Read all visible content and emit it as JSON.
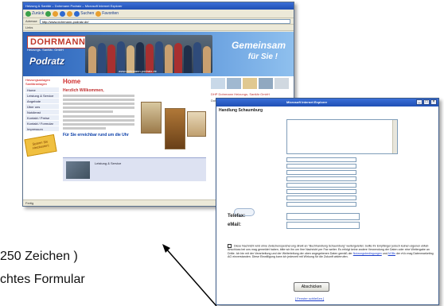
{
  "browser": {
    "title": "Heizung & Sanitär – Dohrmann Podratz – Microsoft Internet Explorer",
    "toolbar": [
      "Zurück",
      "",
      "",
      "",
      "",
      "Suchen",
      "Favoriten"
    ],
    "address_label": "Adresse",
    "address_value": "http://www.dohrmann-podratz.de/",
    "links_label": "Links",
    "status_text": "Fertig",
    "page": {
      "logo_primary": "DOHRMANN",
      "logo_primary_sub": "Heizungs- Sanitär- GmbH",
      "logo_secondary": "Podratz",
      "slogan_line1": "Gemeinsam",
      "slogan_line2": "für Sie !",
      "domain_strip": "www.dohrmann-podratz.de",
      "nav_header": "Heizungsanlagen Sanitäranlagen",
      "nav_items": [
        "Home",
        "Leistung & Service",
        "Angebote",
        "Über uns",
        "Notdienst",
        "Kontakt / Preise",
        "Kontakt / Formular",
        "Impressum"
      ],
      "promo_text": "Sparen Sie Heizkosten!",
      "home_tab": "Home",
      "welcome_heading": "Herzlich Willkommen,",
      "cta": "Für Sie erreichbar rund um die Uhr",
      "mid_banner_text": "Leistung & Service",
      "info_right_heading": "DHP Dohrmann Heizungs- Sanitär GmbH",
      "info_right_body": "Dohrmann Podratz – Meister vom Handwerk"
    }
  },
  "popup": {
    "window_title": "Microsoft Internet Explorer",
    "heading": "Handlung Schaumburg",
    "fields": {
      "telefax_label": "Telefax:",
      "email_label": "eMail:"
    },
    "disclaimer": "Diese Nachricht wird ohne Zwischenspeicherung direkt an \"Buchhandlung Schaumburg\" weitergeleitet. Sollte Ihr Empfänger jedoch keinen eigenen eMail-Anschluss bei uns mag gemeldet haben, bitte wir ihn um Ihre Nachricht per Fax weiter. Es erfolgt keine andere Verwendung der Daten oder eine Weitergabe an Dritte. Ich bin mit der Verarbeitung und der Weiterleitung der oben angegebenen Daten gemäß der",
    "disclaimer_link1": "Nutzungsbedingungen",
    "disclaimer_mid": "und",
    "disclaimer_link2": "AGBs",
    "disclaimer_tail": "der eVo mag Datenmarketing AG einverstanden. Diese Einwilligung kann ich jederzeit mit Wirkung für die Zukunft widerrufen.",
    "send_button": "Abschicken",
    "close_link": "[ Fenster schließen ]"
  },
  "captions": {
    "line1": "250 Zeichen )",
    "line2": "chtes Formular"
  },
  "colors": {
    "titlebar": "#2a5fc8",
    "banner": "#3a74c8",
    "accent_red": "#c0392b",
    "link_blue": "#1a3dcc"
  }
}
